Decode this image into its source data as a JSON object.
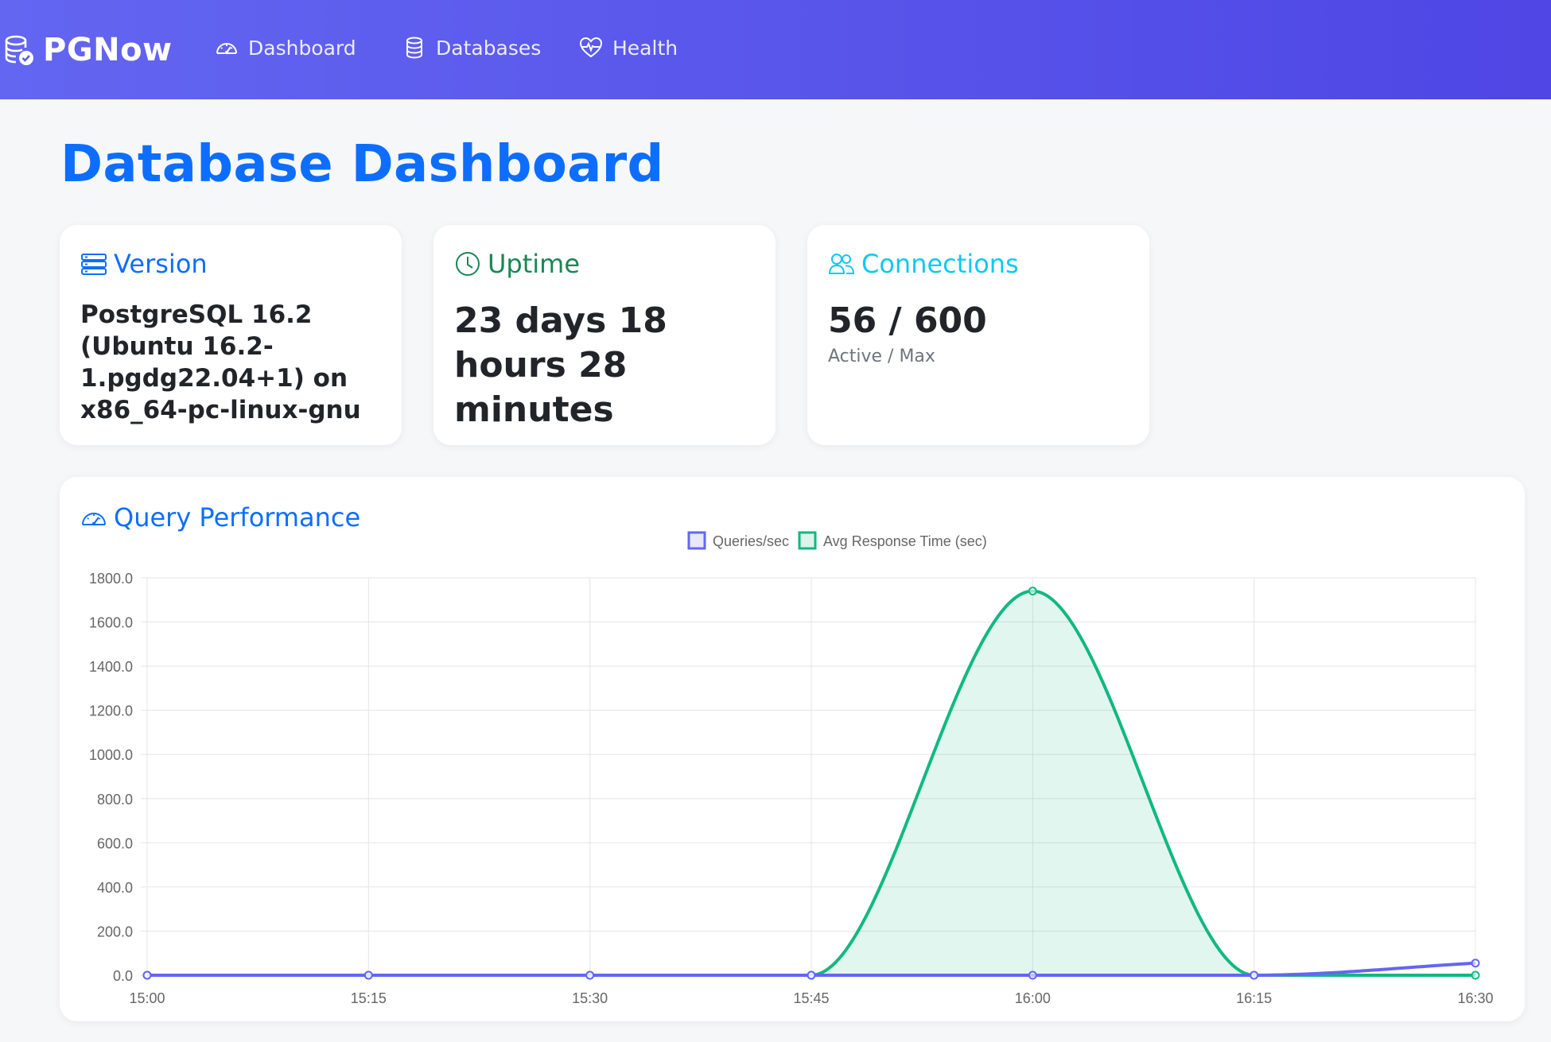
{
  "navbar": {
    "brand": "PGNow",
    "items": [
      {
        "label": "Dashboard",
        "icon": "speedometer-icon"
      },
      {
        "label": "Databases",
        "icon": "database-icon"
      },
      {
        "label": "Health",
        "icon": "heart-pulse-icon"
      }
    ]
  },
  "page": {
    "title": "Database Dashboard"
  },
  "cards": {
    "version": {
      "title": "Version",
      "value": "PostgreSQL 16.2 (Ubuntu 16.2-1.pgdg22.04+1) on x86_64-pc-linux-gnu"
    },
    "uptime": {
      "title": "Uptime",
      "value": "23 days 18 hours 28 minutes"
    },
    "connections": {
      "title": "Connections",
      "value": "56 / 600",
      "subtitle": "Active / Max"
    }
  },
  "colors": {
    "nav_start": "#6366f1",
    "nav_end": "#4f46e5",
    "primary": "#0d6efd",
    "success": "#198754",
    "info": "#0dcaf0",
    "queries_series": "#6366f1",
    "response_series": "#10b981"
  },
  "chart_data": {
    "title": "Query Performance",
    "type": "line",
    "x": [
      "15:00",
      "15:15",
      "15:30",
      "15:45",
      "16:00",
      "16:15",
      "16:30"
    ],
    "series": [
      {
        "name": "Queries/sec",
        "values": [
          0,
          0,
          0,
          0,
          0,
          0,
          55
        ],
        "color": "#6366f1",
        "fill": false
      },
      {
        "name": "Avg Response Time (sec)",
        "values": [
          0,
          0,
          0,
          0,
          1740,
          0,
          0
        ],
        "color": "#10b981",
        "fill": true
      }
    ],
    "y_ticks": [
      "1800.0",
      "1600.0",
      "1400.0",
      "1200.0",
      "1000.0",
      "800.0",
      "600.0",
      "400.0",
      "200.0",
      "0.0"
    ],
    "ylim": [
      0,
      1800
    ],
    "legend": "top-center",
    "grid": true
  }
}
